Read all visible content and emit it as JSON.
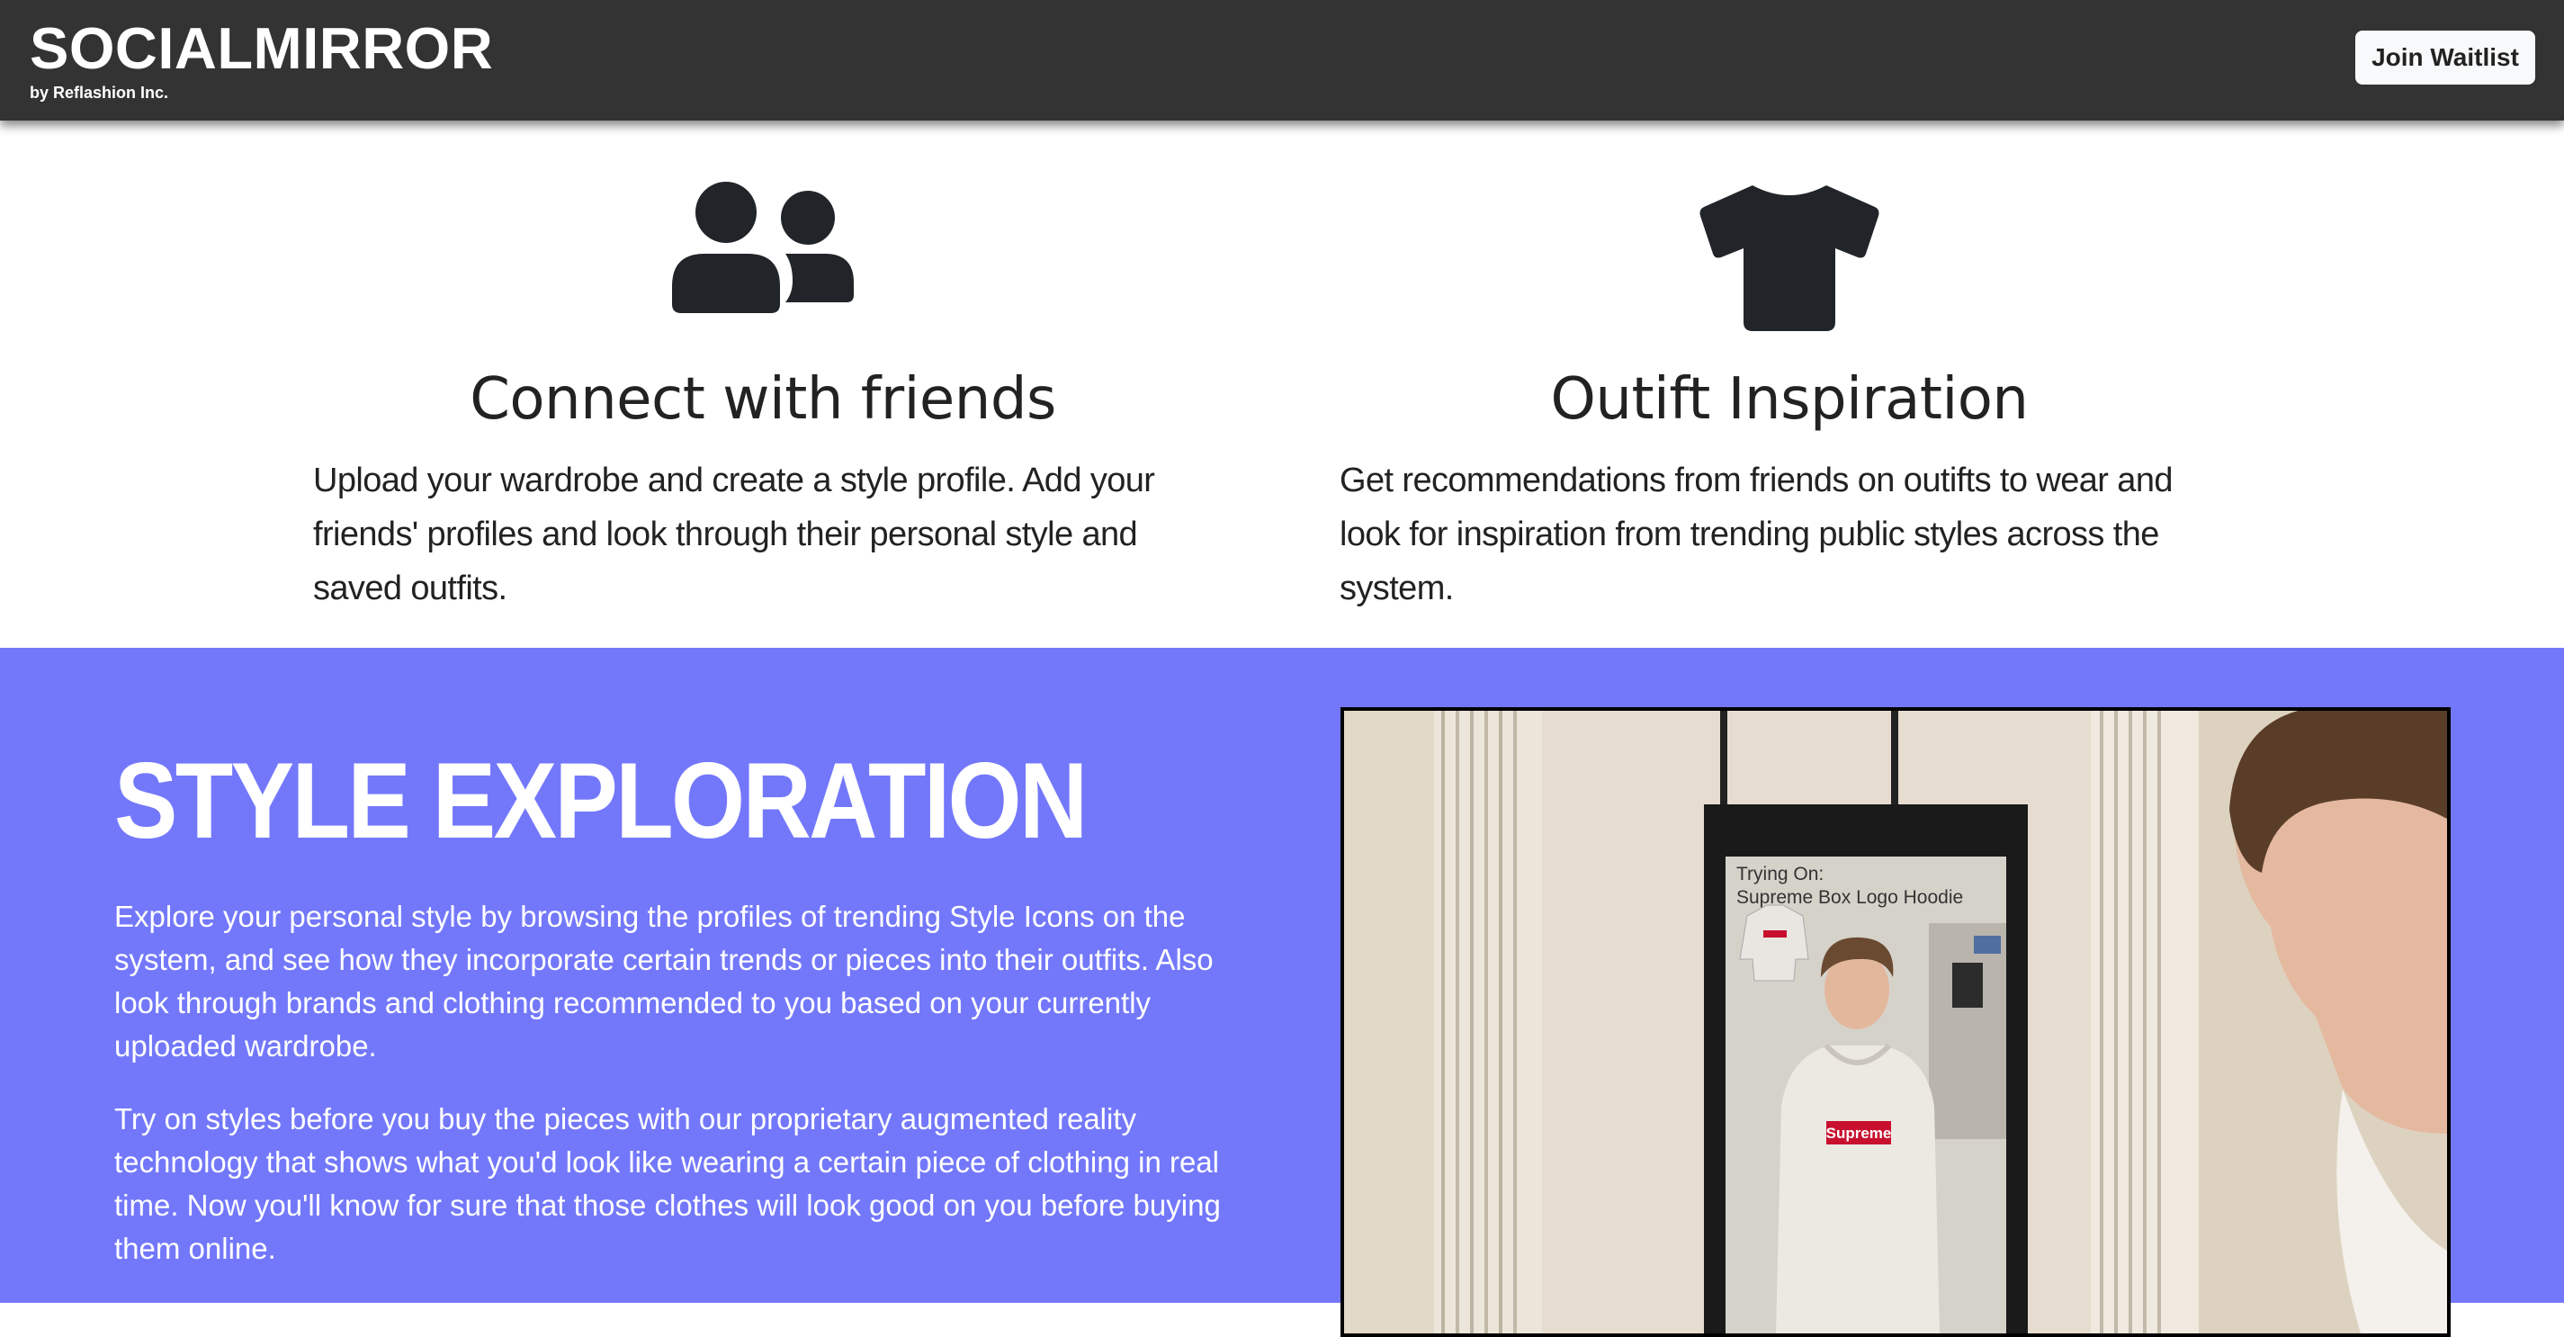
{
  "navbar": {
    "brand": "SOCIALMIRROR",
    "subtitle": "by Reflashion Inc.",
    "cta_label": "Join Waitlist"
  },
  "features": [
    {
      "icon": "users-icon",
      "title": "Connect with friends",
      "description": "Upload your wardrobe and create a style profile. Add your friends' profiles and look through their personal style and saved outfits."
    },
    {
      "icon": "tshirt-icon",
      "title": "Outift Inspiration",
      "description": "Get recommendations from friends on outifts to wear and look for inspiration from trending public styles across the system."
    }
  ],
  "explore": {
    "title": "STYLE EXPLORATION",
    "paragraph1": "Explore your personal style by browsing the profiles of trending Style Icons on the system, and see how they incorporate certain trends or pieces into their outfits. Also look through brands and clothing recommended to you based on your currently uploaded wardrobe.",
    "paragraph2": "Try on styles before you buy the pieces with our proprietary augmented reality technology that shows what you'd look like wearing a certain piece of clothing in real time. Now you'll know for sure that those clothes will look good on you before buying them online.",
    "photo": {
      "overlay_line1": "Trying On:",
      "overlay_line2": "Supreme Box Logo Hoodie",
      "logo_text": "Supreme"
    }
  },
  "colors": {
    "navbar_bg": "#333333",
    "explore_bg": "#7378fb",
    "icon": "#212529"
  }
}
